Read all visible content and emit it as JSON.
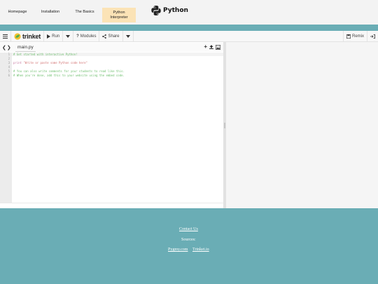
{
  "topnav": {
    "items": [
      {
        "label": "Homepage"
      },
      {
        "label": "Installation"
      },
      {
        "label": "The Basics"
      },
      {
        "label": "Python Interpreter"
      }
    ],
    "logo_text": "Python"
  },
  "toolbar": {
    "brand": "trinket",
    "run_label": "Run",
    "modules_label": "Modules",
    "share_label": "Share",
    "remix_label": "Remix"
  },
  "editor": {
    "filename": "main.py",
    "line_numbers": [
      "1",
      "2",
      "3",
      "4",
      "5",
      "6"
    ],
    "lines": {
      "l1": "# Get started with interactive Python!",
      "l3_kw": "print",
      "l3_str": " \"Write or paste some Python code here\"",
      "l5": "# You can also write comments for your students to read like this.",
      "l6": "# When you're done, add this to your website using the embed code."
    }
  },
  "footer": {
    "contact": "Contact Us",
    "sources": "Sources:",
    "source1": "Pygmy.com",
    "source2": "Trinket.io"
  }
}
